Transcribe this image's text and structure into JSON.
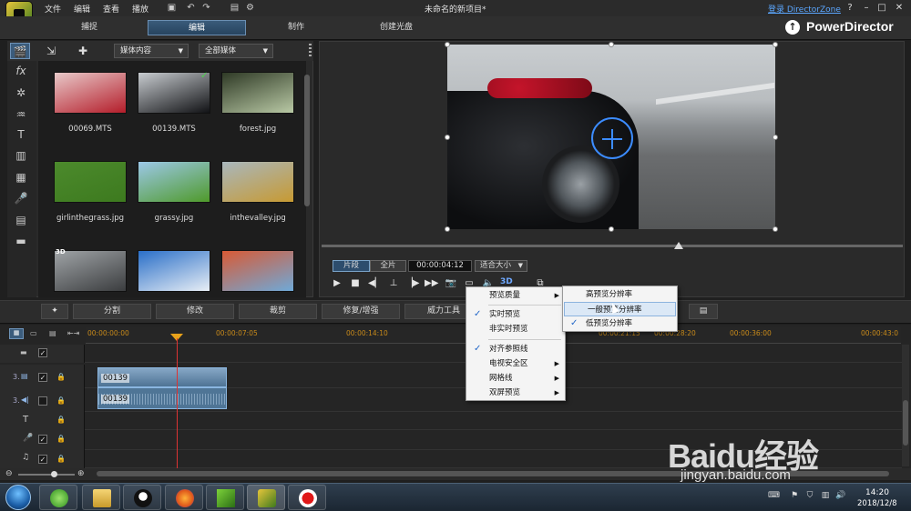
{
  "titlebar": {
    "menus": [
      "文件",
      "编辑",
      "查看",
      "播放"
    ],
    "window_title": "未命名的新项目*",
    "login_link": "登录 DirectorZone",
    "help": "?",
    "minimize": "–",
    "maximize": "□",
    "close": "✕"
  },
  "modes": [
    "捕捉",
    "编辑",
    "制作",
    "创建光盘"
  ],
  "brand": "PowerDirector",
  "library": {
    "content_dropdown": "媒体内容",
    "filter_dropdown": "全部媒体",
    "items": [
      {
        "name": "00069.MTS",
        "colors": [
          "#e8c9c9",
          "#b41d2a"
        ]
      },
      {
        "name": "00139.MTS",
        "colors": [
          "#c8ccd0",
          "#111215"
        ]
      },
      {
        "name": "forest.jpg",
        "colors": [
          "#2f3a26",
          "#b9c9a5"
        ]
      },
      {
        "name": "girlinthegrass.jpg",
        "colors": [
          "#4c8a2c",
          "#3d7a1f"
        ]
      },
      {
        "name": "grassy.jpg",
        "colors": [
          "#9cc8e8",
          "#4f9a2a"
        ]
      },
      {
        "name": "inthevalley.jpg",
        "colors": [
          "#a9b7bd",
          "#c79a32"
        ]
      },
      {
        "name": "",
        "colors": [
          "#9fa3a6",
          "#3b3d3f"
        ]
      },
      {
        "name": "",
        "colors": [
          "#2a6fc8",
          "#e8eef5"
        ]
      },
      {
        "name": "",
        "colors": [
          "#d85a35",
          "#6fa9d8"
        ]
      }
    ]
  },
  "preview": {
    "clip_label": "片段",
    "movie_label": "全片",
    "timecode": "00:00:04:12",
    "fit_label": "适合大小",
    "three_d": "3D"
  },
  "edit_toolbar": [
    "分割",
    "修改",
    "裁剪",
    "修复/增强",
    "威力工具"
  ],
  "timeline": {
    "ticks": [
      "00:00:00:00",
      "00:00:07:05",
      "00:00:14:10",
      "00:00:21:15",
      "00:00:28:20",
      "00:00:36:00",
      "00:00:43:0"
    ],
    "video_track_num": "3.",
    "audio_track_num": "3.",
    "video_clip": "00139",
    "audio_clip": "00139"
  },
  "context_menu": {
    "items": [
      {
        "label": "预览质量",
        "sub": true,
        "checked": false
      },
      {
        "label": "实时预览",
        "sub": false,
        "checked": true
      },
      {
        "label": "非实时预览",
        "sub": false,
        "checked": false
      },
      {
        "label": "对齐参照线",
        "sub": false,
        "checked": true
      },
      {
        "label": "电视安全区",
        "sub": true,
        "checked": false
      },
      {
        "label": "网格线",
        "sub": true,
        "checked": false
      },
      {
        "label": "双屏预览",
        "sub": true,
        "checked": false
      }
    ]
  },
  "submenu": {
    "items": [
      {
        "label": "高预览分辨率",
        "checked": false
      },
      {
        "label": "一般预览分辨率",
        "checked": false
      },
      {
        "label": "低预览分辨率",
        "checked": true
      }
    ]
  },
  "taskbar": {
    "time": "14:20",
    "date": "2018/12/8"
  },
  "watermark": {
    "text": "Baidu经验",
    "url": "jingyan.baidu.com"
  }
}
